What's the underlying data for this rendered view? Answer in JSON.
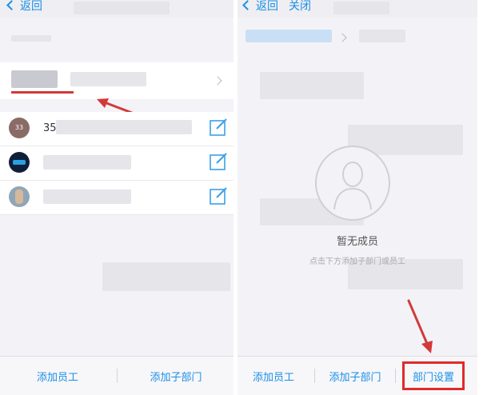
{
  "left_panel": {
    "back_label": "返回",
    "contact_numbers": [
      "35"
    ],
    "avatar_initials": "33",
    "bottom": {
      "add_staff": "添加员工",
      "add_subdept": "添加子部门"
    }
  },
  "right_panel": {
    "back_label": "返回",
    "close_label": "关闭",
    "empty_title": "暂无成员",
    "empty_hint": "点击下方添加子部门或员工",
    "bottom": {
      "add_staff": "添加员工",
      "add_subdept": "添加子部门",
      "dept_settings": "部门设置"
    }
  },
  "annotation_color": "#e02b2b",
  "accent_color": "#1a8fe5"
}
